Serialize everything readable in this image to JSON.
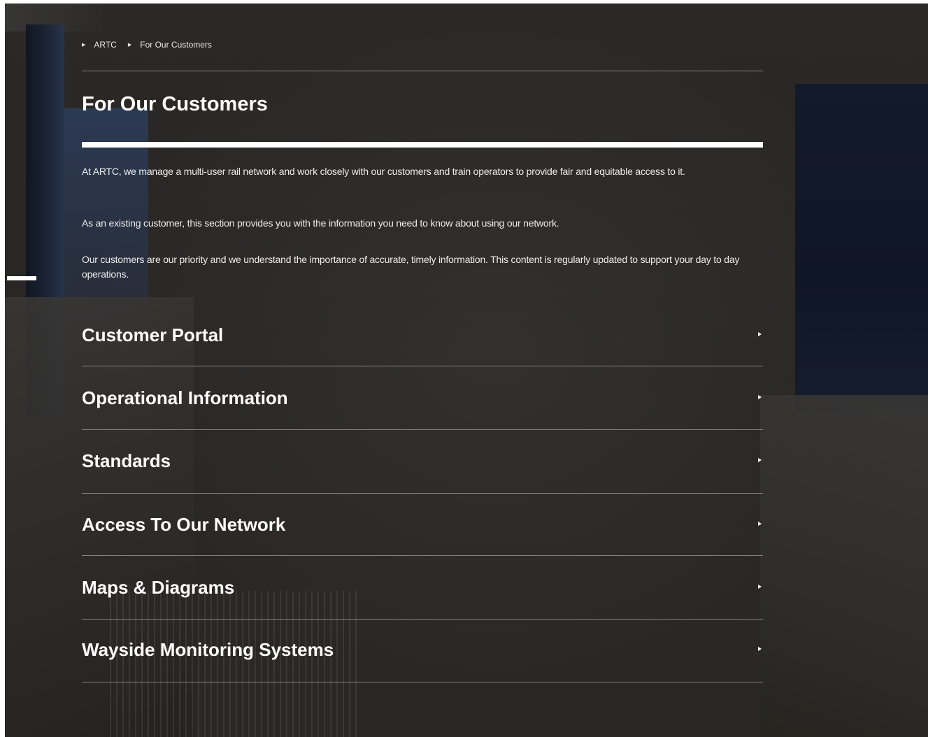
{
  "breadcrumb": {
    "items": [
      {
        "label": "ARTC"
      },
      {
        "label": "For Our Customers"
      }
    ]
  },
  "page": {
    "title": "For Our Customers"
  },
  "intro": {
    "paragraphs": [
      "At ARTC, we manage a multi-user rail network and work closely with our customers and train operators to provide fair and equitable access to it.",
      "As an existing customer, this section provides you with the information you need to know about using our network.",
      "Our customers are our priority and we understand the importance of accurate, timely information. This content is regularly updated to support your day to day operations."
    ]
  },
  "sections": [
    {
      "label": "Customer Portal",
      "icon": "chevron-right-icon"
    },
    {
      "label": "Operational Information",
      "icon": "chevron-right-icon"
    },
    {
      "label": "Standards",
      "icon": "chevron-right-icon"
    },
    {
      "label": "Access To Our Network",
      "icon": "chevron-right-icon"
    },
    {
      "label": "Maps & Diagrams",
      "icon": "chevron-right-icon"
    },
    {
      "label": "Wayside Monitoring Systems",
      "icon": "chevron-right-icon"
    }
  ],
  "colors": {
    "background": "#2a2826",
    "text": "#ffffff",
    "divider": "#8a8886",
    "accent_navy": "#131a2b"
  }
}
